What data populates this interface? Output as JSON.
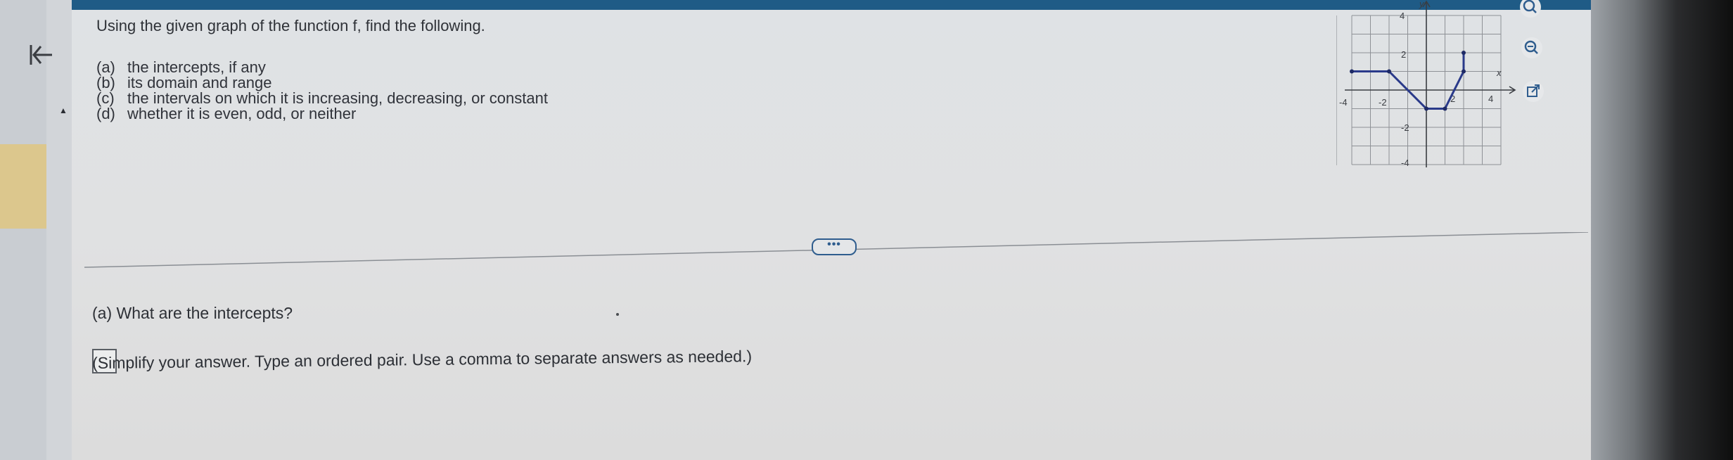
{
  "question": {
    "title": "Using the given graph of the function f, find the following.",
    "parts": [
      {
        "letter": "(a)",
        "text": "the intercepts, if any"
      },
      {
        "letter": "(b)",
        "text": "its domain and range"
      },
      {
        "letter": "(c)",
        "text": "the intervals on which it is increasing, decreasing, or constant"
      },
      {
        "letter": "(d)",
        "text": "whether it is even, odd, or neither"
      }
    ]
  },
  "graph": {
    "x_axis_label": "x",
    "y_axis_label": "y",
    "tick_labels": {
      "x_neg4": "-4",
      "x_neg2": "-2",
      "x_pos2": "2",
      "x_pos4": "4",
      "y_pos4": "4",
      "y_pos2": "2",
      "y_neg2": "-2",
      "y_neg4": "-4"
    },
    "line_color": "#2a3a8a"
  },
  "toolbar": {
    "zoom_in_icon": "zoom-in-icon",
    "zoom_out_icon": "zoom-out-icon",
    "open_external_icon": "external-link-icon"
  },
  "divider": {
    "more_label": "•••"
  },
  "part_a": {
    "question": "(a)  What are the intercepts?",
    "answer_value": "",
    "hint": "(Simplify your answer. Type an ordered pair. Use a comma to separate answers as needed.)"
  },
  "colors": {
    "top_bar": "#1f5b86",
    "accent_blue": "#2f5d8e",
    "left_highlight": "#dcc78d"
  }
}
